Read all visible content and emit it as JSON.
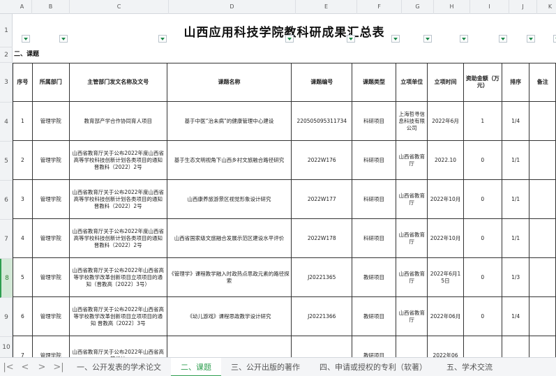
{
  "columns": [
    "A",
    "B",
    "C",
    "D",
    "E",
    "F",
    "G",
    "H",
    "I",
    "J",
    "K"
  ],
  "row_numbers": [
    "1",
    "2",
    "3",
    "4",
    "5",
    "6",
    "7",
    "8",
    "9",
    "10"
  ],
  "active_row": "8",
  "title": "山西应用科技学院教科研成果汇总表",
  "section_label": "二、课题",
  "table": {
    "headers": [
      "序号",
      "所属部门",
      "主管部门发文名称及文号",
      "课题名称",
      "课题编号",
      "课题类型",
      "立项单位",
      "立项时间",
      "资助金额（万元）",
      "排序",
      "备注"
    ],
    "rows": [
      [
        "1",
        "管理学院",
        "教育部产学合作协同育人项目",
        "基于中医“治未病”的健康管理中心建设",
        "220505095311734",
        "科研项目",
        "上海哲寻信息科技有限公司",
        "2022年6月",
        "1",
        "1/4",
        ""
      ],
      [
        "2",
        "管理学院",
        "山西省教育厅关于公布2022年度山西省高等学校科技创新计划各类项目的通知晋教科（2022）2号",
        "基于生态文明视角下山西乡村文旅融合路径研究",
        "2022W176",
        "科研项目",
        "山西省教育厅",
        "2022.10",
        "0",
        "1/1",
        ""
      ],
      [
        "3",
        "管理学院",
        "山西省教育厅关于公布2022年度山西省高等学校科技创新计划各类项目的通知晋教科（2022）2号",
        "山西康养旅游景区视觉形象设计研究",
        "2022W177",
        "科研项目",
        "山西省教育厅",
        "2022年10月",
        "0",
        "1/1",
        ""
      ],
      [
        "4",
        "管理学院",
        "山西省教育厅关于公布2022年度山西省高等学校科技创新计划各类项目的通知晋教科（2022）2号",
        "山西省国家级文旅融合发展示范区建设水平评价",
        "2022W178",
        "科研项目",
        "山西省教育厅",
        "2022年10月",
        "0",
        "1/1",
        ""
      ],
      [
        "5",
        "管理学院",
        "山西省教育厅关于公布2022年山西省高等学校教学改革创新项目立项项目的通知（晋教高〔2022〕3号）",
        "《管理学》课程教学融入时政热点思政元素的路径探索",
        "J20221365",
        "教研项目",
        "山西省教育厅",
        "2022年6月15日",
        "0",
        "1/3",
        ""
      ],
      [
        "6",
        "管理学院",
        "山西省教育厅关于公布2022年山西省高等学校教学改革创新项目立项项目的通知 晋教高〔2022〕3号",
        "《幼儿游戏》课程思政教学设计研究",
        "J20221366",
        "教研项目",
        "山西省教育厅",
        "2022年06月",
        "0",
        "1/4",
        ""
      ],
      [
        "7",
        "管理学院",
        "山西省教育厅关于公布2022年山西省高等学校",
        "",
        "",
        "教研项目",
        "",
        "2022年06",
        "",
        "",
        " "
      ]
    ]
  },
  "sheet_tabs": [
    {
      "label": "一、公开发表的学术论文",
      "active": false
    },
    {
      "label": "二、课题",
      "active": true
    },
    {
      "label": "三、公开出版的著作",
      "active": false
    },
    {
      "label": "四、申请或授权的专利（软著）",
      "active": false
    },
    {
      "label": "五、学术交流",
      "active": false
    }
  ],
  "nav": {
    "first": "|<",
    "prev": "<",
    "next": ">",
    "last": ">|"
  }
}
